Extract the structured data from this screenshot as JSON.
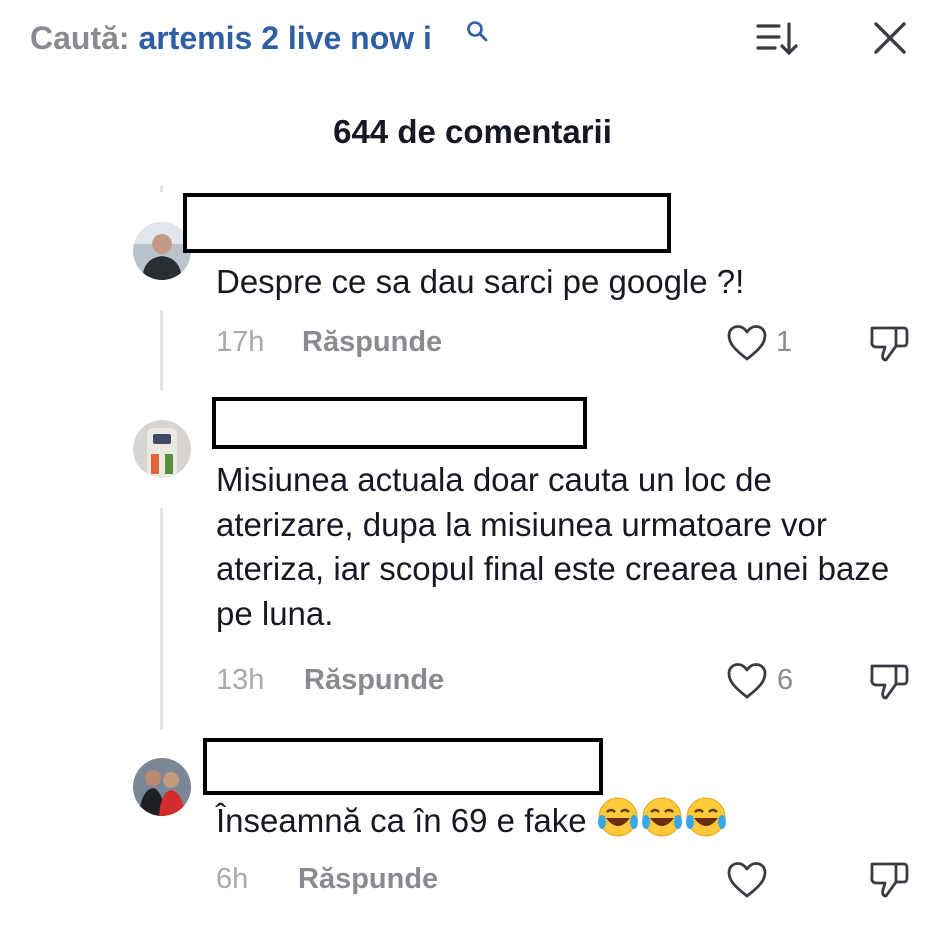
{
  "search": {
    "prefix": "Caută:",
    "query": "artemis 2 live now i"
  },
  "header": {
    "sort_icon": "sort-icon",
    "close_icon": "close-icon"
  },
  "comments_title": "644 de comentarii",
  "comments": [
    {
      "text": "Despre ce sa dau sarci pe google ?!",
      "time": "17h",
      "reply_label": "Răspunde",
      "likes": "1"
    },
    {
      "text": "Misiunea actuala doar cauta un loc de aterizare, dupa la misiunea urmatoare vor ateriza, iar scopul final este crearea unei baze pe luna.",
      "time": "13h",
      "reply_label": "Răspunde",
      "likes": "6"
    },
    {
      "text": "Înseamnă ca în 69 e fake",
      "emoji": "face-with-tears-of-joy x3",
      "time": "6h",
      "reply_label": "Răspunde",
      "likes": ""
    }
  ],
  "colors": {
    "query": "#2f5fa3",
    "muted": "#8a8b91",
    "text": "#161823"
  }
}
